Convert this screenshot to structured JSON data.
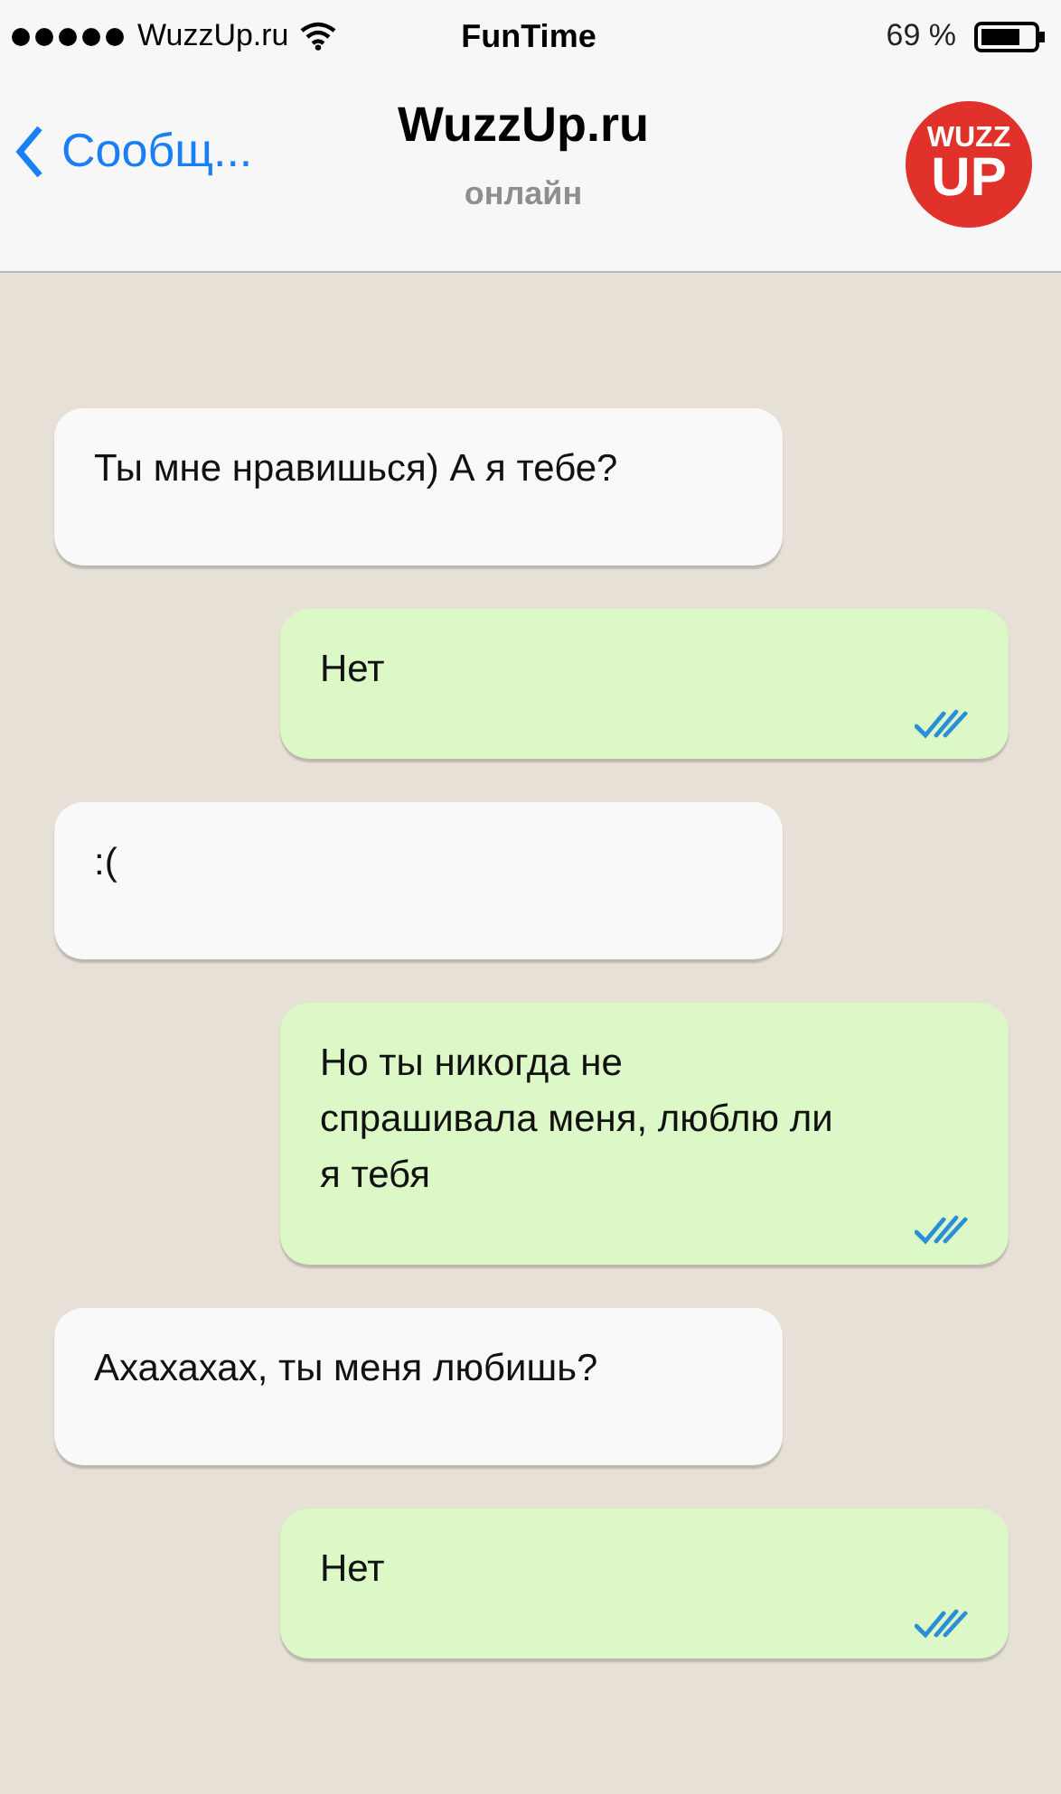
{
  "status_bar": {
    "carrier": "WuzzUp.ru",
    "title": "FunTime",
    "battery": "69 %"
  },
  "nav_bar": {
    "back": "Сообщ...",
    "title": "WuzzUp.ru",
    "subtitle": "онлайн",
    "logo": [
      "WUZZ",
      "UP"
    ]
  },
  "messages": [
    {
      "kind": "incoming",
      "text": "Ты мне нравишься) А я тебе?"
    },
    {
      "kind": "outgoing",
      "text": "Нет",
      "read": true
    },
    {
      "kind": "incoming",
      "text": ":("
    },
    {
      "kind": "outgoing",
      "text": "Но ты никогда не\nспрашивала меня, люблю ли\nя тебя",
      "read": true
    },
    {
      "kind": "incoming",
      "text": "Ахахахах, ты меня любишь?"
    },
    {
      "kind": "outgoing",
      "text": "Нет",
      "read": true
    }
  ]
}
